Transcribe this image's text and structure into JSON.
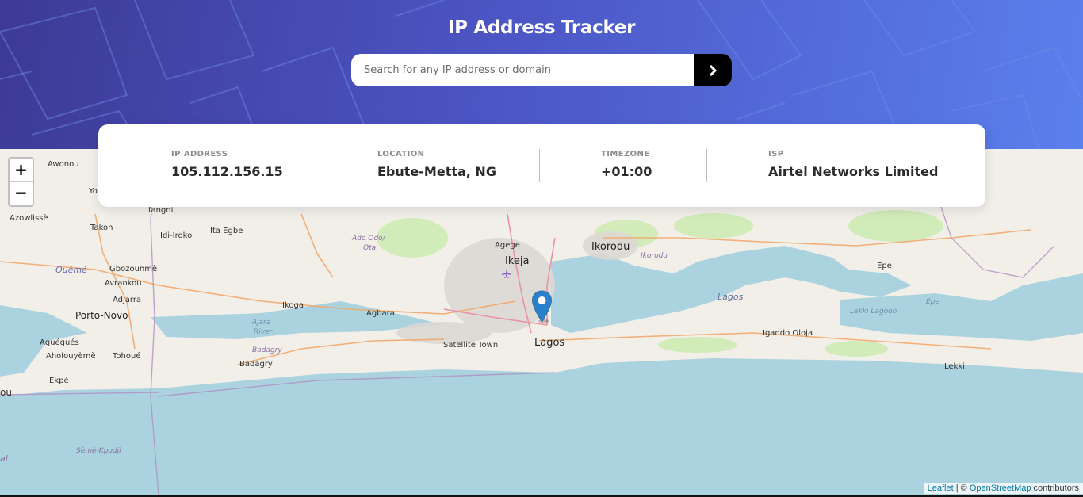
{
  "header": {
    "title": "IP Address Tracker",
    "search_placeholder": "Search for any IP address or domain",
    "search_value": "",
    "submit_icon": "chevron-right-icon"
  },
  "info": {
    "ip_label": "IP ADDRESS",
    "ip_value": "105.112.156.15",
    "location_label": "LOCATION",
    "location_value": "Ebute-Metta, NG",
    "timezone_label": "TIMEZONE",
    "timezone_value": "+01:00",
    "isp_label": "ISP",
    "isp_value": "Airtel Networks Limited"
  },
  "map": {
    "zoom_in": "+",
    "zoom_out": "−",
    "attribution_leaflet": "Leaflet",
    "attribution_sep": " | © ",
    "attribution_osm": "OpenStreetMap",
    "attribution_suffix": " contributors",
    "places": {
      "awonou": "Awonou",
      "azowlisse": "Azowlissè",
      "yo": "Yo",
      "ifangni": "Ifangni",
      "takon": "Takon",
      "idi_iroko": "Idi-Iroko",
      "ita_egbe": "Ita Egbe",
      "oueme": "Ouémé",
      "gbozounme": "Gbozounmè",
      "avrankou": "Avrankou",
      "adjarra": "Adjarra",
      "porto_novo": "Porto-Novo",
      "aguegues": "Aguégués",
      "aholouyeme": "Aholouyèmè",
      "tohoue": "Tohoué",
      "ekpe": "Ekpè",
      "ou": "ou",
      "ikoga": "Ikoga",
      "ado_odo_1": "Ado Odo/",
      "ado_odo_2": "Ota",
      "agbara": "Agbara",
      "ajara_1": "Ajara",
      "ajara_2": "River",
      "badagry_it": "Badagry",
      "badagry": "Badagry",
      "agege": "Agege",
      "ikeja": "Ikeja",
      "ikorodu": "Ikorodu",
      "ikorodu_it": "Ikorodu",
      "satellite_town": "Satellite Town",
      "lagos": "Lagos",
      "lagos_it": "Lagos",
      "epe": "Epe",
      "epe_it": "Epe",
      "lekki_lagoon": "Lekki Lagoon",
      "igando_oloja": "Igando Oloja",
      "lekki": "Lekki",
      "seme_kpodji": "Sèmè-Kpodji",
      "al": "al"
    }
  },
  "colors": {
    "header_start": "#3d3a95",
    "header_end": "#5a80ed",
    "sea": "#aad3df",
    "land": "#f2efe9",
    "marker": "#2a81cb"
  }
}
